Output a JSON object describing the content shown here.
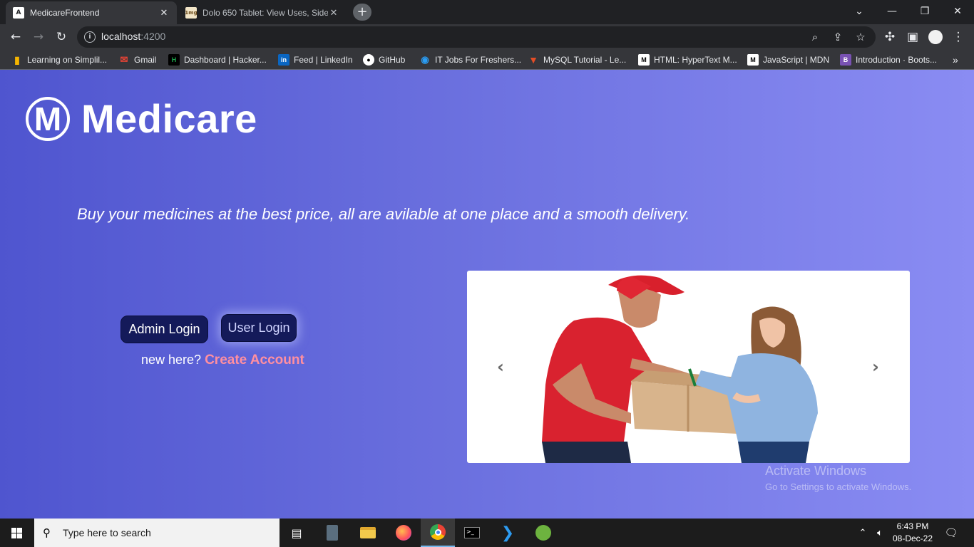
{
  "browser": {
    "tabs": [
      {
        "title": "MedicareFrontend",
        "favicon": "angular-icon",
        "active": true
      },
      {
        "title": "Dolo 650 Tablet: View Uses, Side",
        "favicon": "1mg-icon",
        "active": false
      }
    ],
    "favicon_letters": {
      "angular": "A",
      "onemg": "1mg"
    },
    "address": {
      "host": "localhost",
      "port": ":4200"
    },
    "bookmarks": [
      {
        "label": "Learning on Simplil...",
        "icon": "simplilearn-icon",
        "color": "#f6b500"
      },
      {
        "label": "Gmail",
        "icon": "gmail-icon",
        "color": "#ea4335"
      },
      {
        "label": "Dashboard | Hacker...",
        "icon": "hackerrank-icon",
        "color": "#1ba94c"
      },
      {
        "label": "Feed | LinkedIn",
        "icon": "linkedin-icon",
        "color": "#0a66c2"
      },
      {
        "label": "GitHub",
        "icon": "github-icon",
        "color": "#ffffff"
      },
      {
        "label": "IT Jobs For Freshers...",
        "icon": "jobs-icon",
        "color": "#2a9df4"
      },
      {
        "label": "MySQL Tutorial - Le...",
        "icon": "mysql-icon",
        "color": "#e44d26"
      },
      {
        "label": "HTML: HyperText M...",
        "icon": "mdn-icon",
        "color": "#ffffff"
      },
      {
        "label": "JavaScript | MDN",
        "icon": "mdn-icon",
        "color": "#ffffff"
      },
      {
        "label": "Introduction · Boots...",
        "icon": "bootstrap-icon",
        "color": "#7952b3"
      }
    ]
  },
  "page": {
    "brand": {
      "mark": "M",
      "name": "Medicare"
    },
    "tagline": "Buy your medicines at the best price, all are avilable at one place and a smooth delivery.",
    "admin_login": "Admin Login",
    "user_login": "User Login",
    "new_here": "new here?",
    "create_account": "Create Account",
    "colors": {
      "gradient_start": "#4f55cf",
      "gradient_end": "#8a8cf3",
      "button_bg": "#141a5a",
      "create_account": "#ff8fa0"
    }
  },
  "watermark": {
    "line1": "Activate Windows",
    "line2": "Go to Settings to activate Windows."
  },
  "taskbar": {
    "search_placeholder": "Type here to search",
    "time": "6:43 PM",
    "date": "08-Dec-22"
  }
}
